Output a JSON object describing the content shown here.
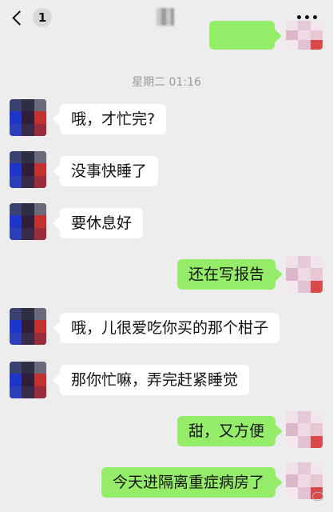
{
  "header": {
    "back_badge": "1"
  },
  "timestamp": "星期二 01:16",
  "messages": [
    {
      "side": "in",
      "text": "哦，才忙完?"
    },
    {
      "side": "in",
      "text": "没事快睡了"
    },
    {
      "side": "in",
      "text": "要休息好"
    },
    {
      "side": "out",
      "text": "还在写报告"
    },
    {
      "side": "in",
      "text": "哦，儿很爱吃你买的那个柑子"
    },
    {
      "side": "in",
      "text": "那你忙嘛，弄完赶紧睡觉"
    },
    {
      "side": "out",
      "text": "甜，又方便"
    },
    {
      "side": "out",
      "text": "今天进隔离重症病房了"
    }
  ],
  "colors": {
    "background": "#ededed",
    "incoming_bubble": "#ffffff",
    "outgoing_bubble": "#95ec69",
    "timestamp_text": "#9a9a9a"
  },
  "icons": {
    "back": "chevron-left-icon",
    "more": "more-dots-icon"
  }
}
